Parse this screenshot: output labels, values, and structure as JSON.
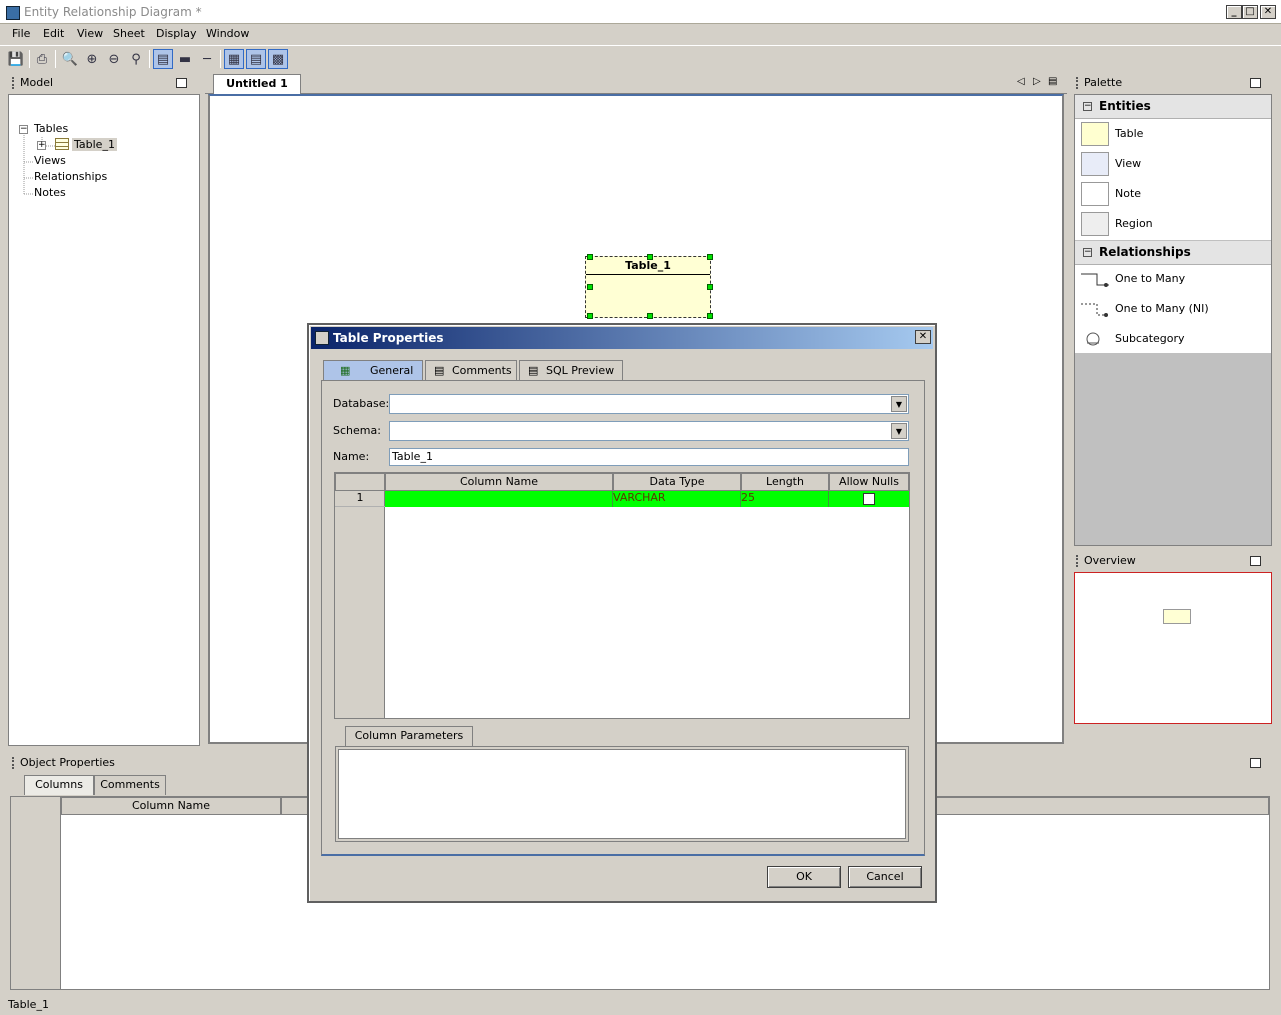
{
  "window": {
    "title": "Entity Relationship Diagram *",
    "controls": [
      "_",
      "□",
      "✕"
    ]
  },
  "menu": [
    "File",
    "Edit",
    "View",
    "Sheet",
    "Display",
    "Window"
  ],
  "toolbar_icons": [
    "save-icon",
    "print-icon",
    "zoom-icon",
    "zoom-in-icon",
    "zoom-out-icon",
    "zoom-fit-icon",
    "view-full-icon",
    "view-compact-icon",
    "view-header-icon",
    "layout-1-icon",
    "layout-2-icon",
    "layout-3-icon"
  ],
  "model_panel": {
    "title": "Model",
    "tree": {
      "tables_label": "Tables",
      "table_item": "Table_1",
      "views_label": "Views",
      "relationships_label": "Relationships",
      "notes_label": "Notes"
    }
  },
  "editor": {
    "tab_label": "Untitled 1",
    "entity_name": "Table_1"
  },
  "palette": {
    "title": "Palette",
    "entities_header": "Entities",
    "entities": [
      "Table",
      "View",
      "Note",
      "Region"
    ],
    "relationships_header": "Relationships",
    "relationships": [
      "One to Many",
      "One to Many (NI)",
      "Subcategory"
    ]
  },
  "overview": {
    "title": "Overview"
  },
  "object_properties": {
    "title": "Object Properties",
    "tabs": [
      "Columns",
      "Comments"
    ],
    "column_header": "Column Name"
  },
  "status": {
    "text": "Table_1"
  },
  "dialog": {
    "title": "Table Properties",
    "tabs": [
      "General",
      "Comments",
      "SQL Preview"
    ],
    "database_label": "Database:",
    "database_value": "",
    "schema_label": "Schema:",
    "schema_value": "",
    "name_label": "Name:",
    "name_value": "Table_1",
    "grid_headers": [
      "Column Name",
      "Data Type",
      "Length",
      "Allow Nulls"
    ],
    "rows": [
      {
        "num": "1",
        "column_name": "",
        "data_type": "VARCHAR",
        "length": "25",
        "allow_nulls": false
      }
    ],
    "column_params_tab": "Column Parameters",
    "ok_label": "OK",
    "cancel_label": "Cancel"
  },
  "colors": {
    "selected_row": "#00ff00",
    "entity_fill": "#ffffd4",
    "dialog_title_start": "#0a246a",
    "dialog_title_end": "#a6caf0"
  }
}
